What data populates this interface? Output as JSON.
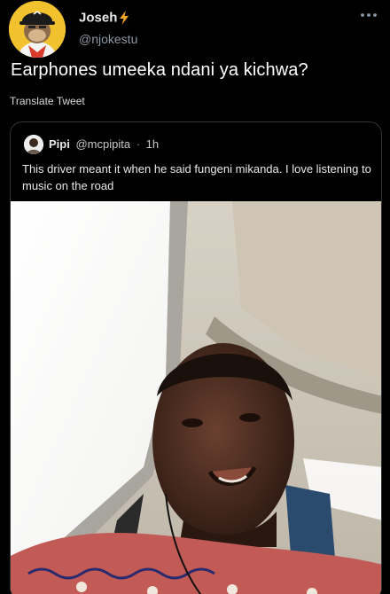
{
  "tweet": {
    "author_name": "Joseh",
    "author_handle": "@njokestu",
    "text": "Earphones umeeka ndani ya kichwa?",
    "translate_label": "Translate Tweet"
  },
  "quoted_tweet": {
    "author_name": "Pipi",
    "author_handle": "@mcpipita",
    "separator": "·",
    "time": "1h",
    "text": "This driver meant it when he said fungeni mikanda. I love listening to music on the road"
  },
  "icons": {
    "verified_emoji": "lightning-bolt-icon",
    "menu": "more-options-icon"
  },
  "colors": {
    "background": "#000000",
    "bolt": "#f5a623",
    "avatar_bg": "#f2c12e",
    "muted_text": "#8b98a5",
    "card_border": "#2f3336"
  }
}
